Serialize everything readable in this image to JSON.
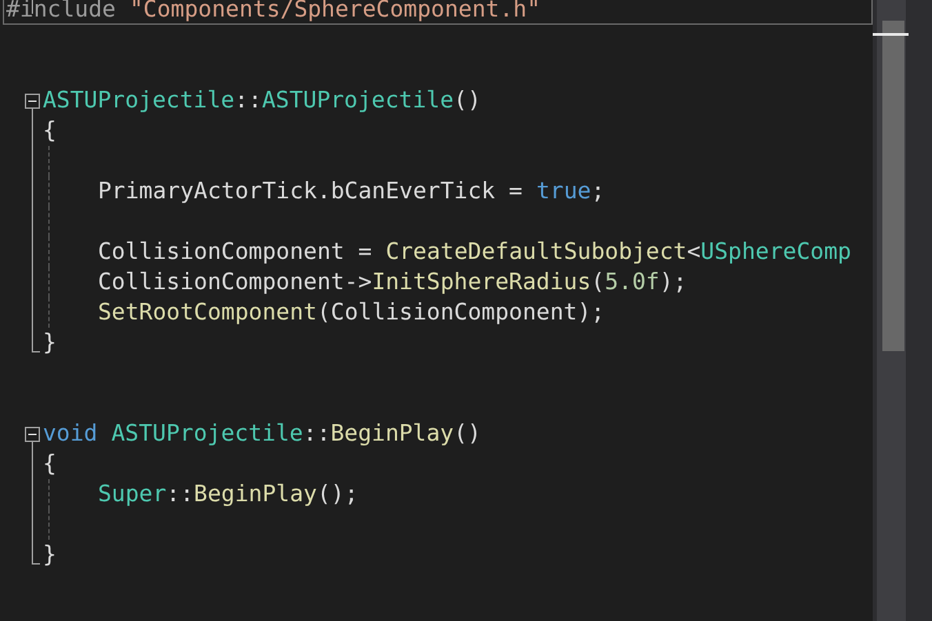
{
  "editor": {
    "lines": [
      {
        "kind": "collapsed",
        "tokens": [
          {
            "kind": "preproc",
            "text": "#include"
          },
          {
            "kind": "string",
            "gap": true,
            "text": "\"Components/SphereComponent.h\""
          }
        ]
      },
      {
        "kind": "plain"
      },
      {
        "kind": "plain"
      },
      {
        "kind": "fold_start",
        "tokens": [
          {
            "kind": "type",
            "text": "ASTUProjectile"
          },
          {
            "kind": "plain",
            "text": "::"
          },
          {
            "kind": "type",
            "text": "ASTUProjectile"
          },
          {
            "kind": "plain",
            "text": "()"
          }
        ]
      },
      {
        "kind": "fold_body",
        "tokens": [
          {
            "kind": "plain",
            "text": "{"
          }
        ]
      },
      {
        "kind": "fold_body"
      },
      {
        "kind": "fold_body",
        "indented": true,
        "tokens": [
          {
            "kind": "plain",
            "text": "PrimaryActorTick.bCanEverTick ="
          },
          {
            "kind": "keyword",
            "gap": true,
            "text": "true"
          },
          {
            "kind": "plain",
            "text": ";"
          }
        ]
      },
      {
        "kind": "fold_body"
      },
      {
        "kind": "fold_body",
        "indented": true,
        "tokens": [
          {
            "kind": "plain",
            "text": "CollisionComponent ="
          },
          {
            "kind": "func",
            "gap": true,
            "text": "CreateDefaultSubobject"
          },
          {
            "kind": "plain",
            "text": "<"
          },
          {
            "kind": "type",
            "text": "USphereComp"
          }
        ]
      },
      {
        "kind": "fold_body",
        "indented": true,
        "tokens": [
          {
            "kind": "plain",
            "text": "CollisionComponent->"
          },
          {
            "kind": "func",
            "text": "InitSphereRadius"
          },
          {
            "kind": "plain",
            "text": "("
          },
          {
            "kind": "number",
            "text": "5.0f"
          },
          {
            "kind": "plain",
            "text": ");"
          }
        ]
      },
      {
        "kind": "fold_body",
        "indented": true,
        "tokens": [
          {
            "kind": "func",
            "text": "SetRootComponent"
          },
          {
            "kind": "plain",
            "text": "(CollisionComponent);"
          }
        ]
      },
      {
        "kind": "fold_end",
        "tokens": [
          {
            "kind": "plain",
            "text": "}"
          }
        ]
      },
      {
        "kind": "plain"
      },
      {
        "kind": "plain"
      },
      {
        "kind": "fold_start",
        "tokens": [
          {
            "kind": "keyword",
            "text": "void"
          },
          {
            "kind": "type",
            "gap": true,
            "text": "ASTUProjectile"
          },
          {
            "kind": "plain",
            "text": "::"
          },
          {
            "kind": "func",
            "text": "BeginPlay"
          },
          {
            "kind": "plain",
            "text": "()"
          }
        ]
      },
      {
        "kind": "fold_body",
        "tokens": [
          {
            "kind": "plain",
            "text": "{"
          }
        ]
      },
      {
        "kind": "fold_body",
        "indented": true,
        "tokens": [
          {
            "kind": "type",
            "text": "Super"
          },
          {
            "kind": "plain",
            "text": "::"
          },
          {
            "kind": "func",
            "text": "BeginPlay"
          },
          {
            "kind": "plain",
            "text": "();"
          }
        ]
      },
      {
        "kind": "fold_body"
      },
      {
        "kind": "fold_end",
        "tokens": [
          {
            "kind": "plain",
            "text": "}"
          }
        ]
      }
    ]
  }
}
